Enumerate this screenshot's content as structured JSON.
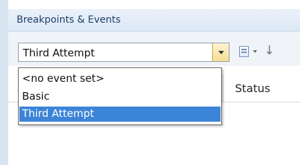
{
  "panel": {
    "title": "Breakpoints & Events"
  },
  "toolbar": {
    "event_set_value": "Third Attempt",
    "icons": [
      "document-list-icon",
      "chevron-down-icon",
      "arrow-down-icon"
    ]
  },
  "dropdown": {
    "options": [
      "<no event set>",
      "Basic",
      "Third Attempt"
    ],
    "selected": "Third Attempt"
  },
  "grid": {
    "columns": [
      "Status"
    ]
  },
  "colors": {
    "selection": "#3c84d7",
    "title_background": "#dde8f5",
    "combo_arrow": "#f7dd8f"
  }
}
